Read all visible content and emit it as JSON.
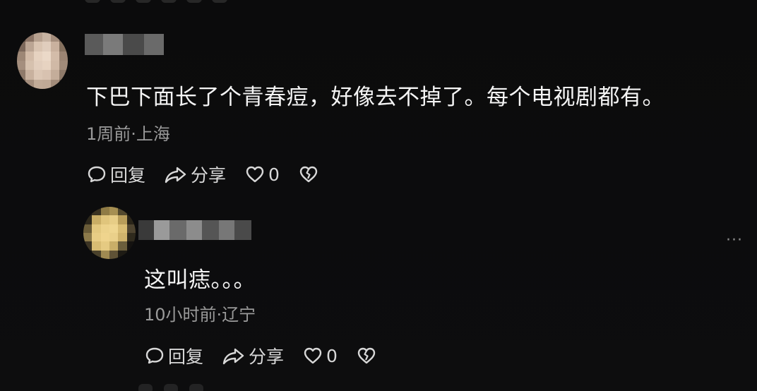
{
  "comment": {
    "text": "下巴下面长了个青春痘，好像去不掉了。每个电视剧都有。",
    "meta": "1周前·上海",
    "actions": {
      "reply_label": "回复",
      "share_label": "分享",
      "like_count": "0"
    }
  },
  "reply": {
    "text": "这叫痣。。。",
    "meta": "10小时前·辽宁",
    "actions": {
      "reply_label": "回复",
      "share_label": "分享",
      "like_count": "0"
    },
    "more_label": "···"
  },
  "icons": {
    "reply": "chat-bubble-icon",
    "share": "share-arrow-icon",
    "like": "heart-icon",
    "dislike": "broken-heart-icon",
    "more": "more-icon"
  },
  "colors": {
    "background": "#0a0a0b",
    "text": "#f4f4f4",
    "meta": "#9a9a9a",
    "action": "#d8d8d8"
  }
}
